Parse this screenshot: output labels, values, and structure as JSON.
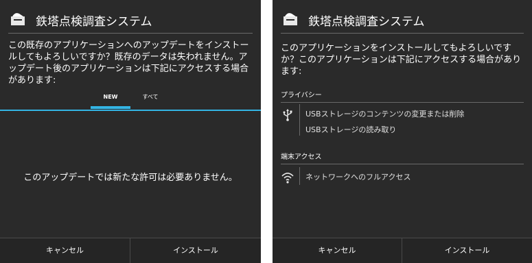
{
  "left": {
    "title": "鉄塔点検調査システム",
    "message": "この既存のアプリケーションへのアップデートをインストールしてもよろしいですか？既存のデータは失われません。アップデート後のアプリケーションは下記にアクセスする場合があります:",
    "tabs": [
      "NEW",
      "すべて"
    ],
    "empty_message": "このアップデートでは新たな許可は必要ありません。",
    "cancel_label": "キャンセル",
    "install_label": "インストール"
  },
  "right": {
    "title": "鉄塔点検調査システム",
    "message": "このアプリケーションをインストールしてもよろしいですか？このアプリケーションは下記にアクセスする場合があります:",
    "sections": [
      {
        "header": "プライバシー",
        "icon": "usb-icon",
        "items": [
          "USBストレージのコンテンツの変更または削除",
          "USBストレージの読み取り"
        ]
      },
      {
        "header": "端末アクセス",
        "icon": "wifi-icon",
        "items": [
          "ネットワークへのフルアクセス"
        ]
      }
    ],
    "cancel_label": "キャンセル",
    "install_label": "インストール"
  },
  "colors": {
    "panel_bg": "#2a2a2a",
    "accent": "#33b5e5"
  }
}
